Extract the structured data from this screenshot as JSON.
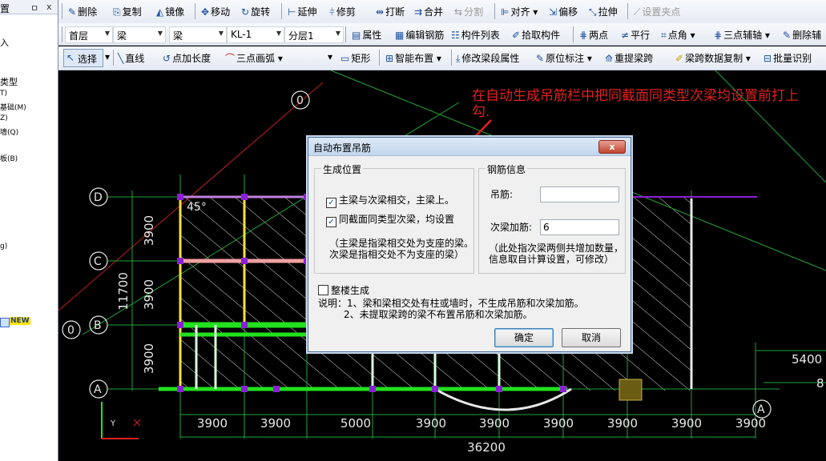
{
  "left_panel": {
    "title": "置",
    "pin": "ㅁ",
    "close": "x",
    "rows": [
      "入",
      "类型",
      "T)",
      "基础(M)",
      "Z)",
      "墙(Q)",
      "板(B)",
      "g)"
    ],
    "new_badge": "NEW"
  },
  "toolbar1": {
    "items": [
      "删除",
      "复制",
      "镜像",
      "移动",
      "旋转",
      "延伸",
      "修剪",
      "打断",
      "合并",
      "分割",
      "对齐",
      "偏移",
      "拉伸",
      "设置夹点"
    ]
  },
  "toolbar2": {
    "floor": "首层",
    "type1": "梁",
    "type2": "梁",
    "element": "KL-1",
    "layer": "分层1",
    "items": [
      "属性",
      "编辑钢筋",
      "构件列表",
      "拾取构件",
      "两点",
      "平行",
      "点角",
      "三点辅轴",
      "删除辅"
    ]
  },
  "toolbar3": {
    "select": "选择",
    "items": [
      "直线",
      "点加长度",
      "三点画弧",
      "矩形",
      "智能布置",
      "修改梁段属性",
      "原位标注",
      "重提梁跨",
      "梁跨数据复制",
      "批量识别"
    ]
  },
  "annotation": "在自动生成吊筋栏中把同截面同类型次梁均设置前打上勾.",
  "drawing": {
    "axis_labels": [
      "D",
      "C",
      "B",
      "A",
      "A",
      "0",
      "0"
    ],
    "dims_left": [
      "3900",
      "3900",
      "3900"
    ],
    "dim_total_left": "11700",
    "dims_bottom": [
      "3900",
      "3900",
      "5000",
      "3900",
      "3900",
      "3900",
      "3900",
      "3900",
      "3900"
    ],
    "dim_total_bottom": "36200",
    "dims_right": [
      "5400",
      "8"
    ],
    "angle": "45°",
    "ucs_y": "Y"
  },
  "colors": {
    "canvas": "#000000",
    "grid": "#21a53a",
    "beam": "#22e11e",
    "col": "#8c1fd6",
    "annot": "#e02020"
  },
  "dialog": {
    "title": "自动布置吊筋",
    "close": "x",
    "group_position": "生成位置",
    "chk1": "主梁与次梁相交，主梁上。",
    "chk2": "同截面同类型次梁，均设置",
    "note1": "（主梁是指梁相交处为支座的梁。",
    "note2": "次梁是指相交处不为支座的梁）",
    "group_rebar": "钢筋信息",
    "label_hanger": "吊筋:",
    "hanger_value": "",
    "label_secondary": "次梁加筋:",
    "secondary_value": "6",
    "info1": "（此处指次梁两侧共增加数量，",
    "info2": "信息取自计算设置，可修改）",
    "chk3": "整楼生成",
    "desc1": "说明：1、梁和梁相交处有柱或墙时，不生成吊筋和次梁加筋。",
    "desc2": "2、未提取梁跨的梁不布置吊筋和次梁加筋。",
    "ok": "确定",
    "cancel": "取消"
  }
}
